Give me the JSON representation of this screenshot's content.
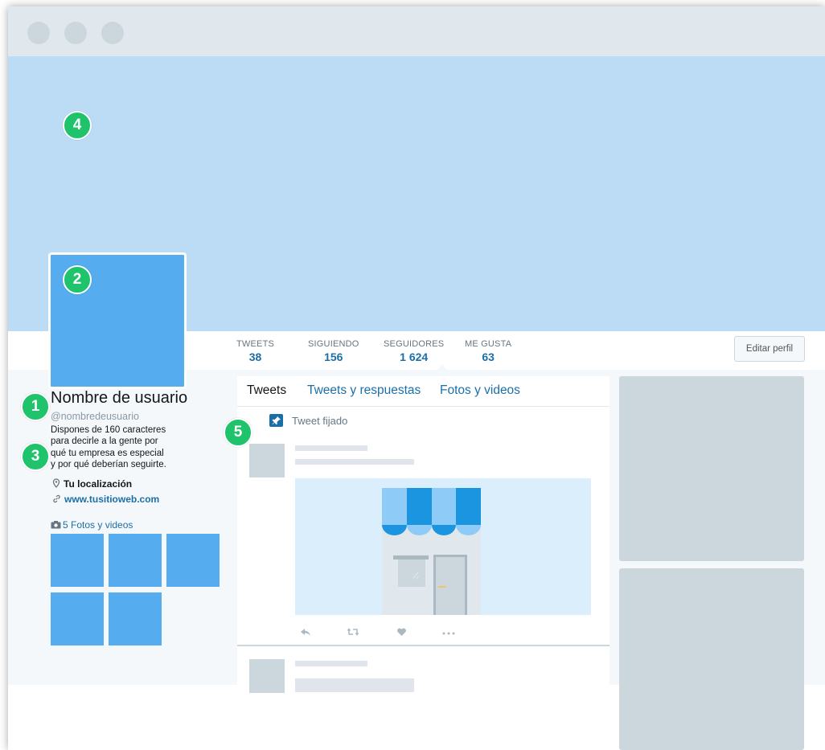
{
  "profile": {
    "name": "Nombre de usuario",
    "handle": "@nombredeusuario",
    "bio_lines": [
      "Dispones de 160 caracteres",
      "para decirle a la gente por",
      "qué tu empresa es especial",
      "y por qué deberían seguirte."
    ],
    "location": "Tu localización",
    "website": "www.tusitioweb.com",
    "photos_label": "5 Fotos y videos",
    "photo_count": 5
  },
  "stats": [
    {
      "label": "TWEETS",
      "value": "38"
    },
    {
      "label": "SIGUIENDO",
      "value": "156"
    },
    {
      "label": "SEGUIDORES",
      "value": "1 624"
    },
    {
      "label": "ME GUSTA",
      "value": "63"
    }
  ],
  "edit_button": "Editar perfil",
  "tabs": [
    "Tweets",
    "Tweets y respuestas",
    "Fotos y videos"
  ],
  "pinned_label": "Tweet fijado",
  "badges": [
    "1",
    "2",
    "3",
    "4",
    "5"
  ],
  "colors": {
    "banner": "#bbdcf4",
    "avatar": "#55acee",
    "badge": "#1fc36b",
    "link": "#1b6fa8"
  },
  "icons": [
    "location-pin-icon",
    "link-icon",
    "camera-icon",
    "pin-icon",
    "reply-icon",
    "retweet-icon",
    "like-icon",
    "more-icon"
  ]
}
